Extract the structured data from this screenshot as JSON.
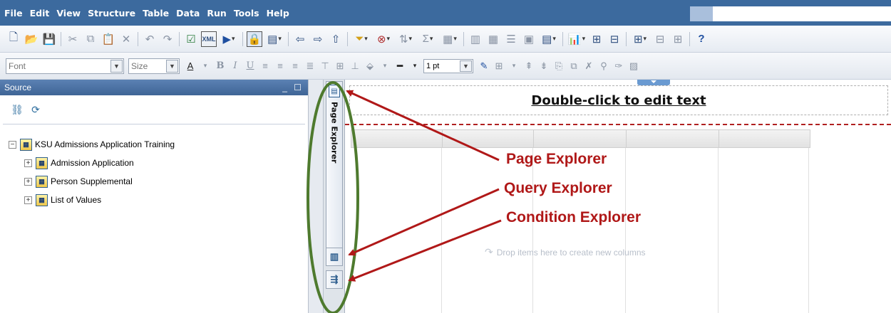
{
  "menubar": {
    "items": [
      "File",
      "Edit",
      "View",
      "Structure",
      "Table",
      "Data",
      "Run",
      "Tools",
      "Help"
    ],
    "search_value": ""
  },
  "toolbar2": {
    "font_placeholder": "Font",
    "size_placeholder": "Size",
    "line_width_value": "1 pt"
  },
  "source_pane": {
    "title": "Source",
    "tree": {
      "root": "KSU Admissions Application Training",
      "children": [
        "Admission Application",
        "Person Supplemental",
        "List of Values"
      ]
    }
  },
  "side_tabs": {
    "page_explorer": "Page Explorer"
  },
  "report": {
    "title_text": "Double-click to edit text",
    "drop_hint": "Drop items here to create new columns"
  },
  "annotations": {
    "labels": [
      "Page Explorer",
      "Query Explorer",
      "Condition Explorer"
    ],
    "color": "#b01818",
    "ellipse_color": "#4e7a2e"
  },
  "colors": {
    "menubar": "#3c6a9e",
    "pane_header": "#4a71a5"
  }
}
